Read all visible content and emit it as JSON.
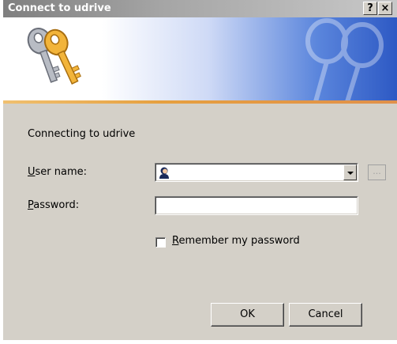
{
  "window": {
    "title": "Connect to udrive",
    "help_button": "?",
    "close_button": "×"
  },
  "banner": {
    "icon": "keys-icon",
    "watermark_icon": "keys-icon"
  },
  "content": {
    "connecting_text": "Connecting to udrive",
    "username": {
      "label_accel": "U",
      "label_rest": "ser name:",
      "value": "",
      "icon": "user-icon"
    },
    "password": {
      "label_accel": "P",
      "label_rest": "assword:",
      "value": ""
    },
    "browse_button": "...",
    "remember": {
      "label_accel": "R",
      "label_rest": "emember my password",
      "checked": false
    }
  },
  "buttons": {
    "ok": "OK",
    "cancel": "Cancel"
  },
  "colors": {
    "dialog_bg": "#d4d0c8",
    "banner_blue": "#2d59c4",
    "stripe_orange": "#e6a040"
  }
}
